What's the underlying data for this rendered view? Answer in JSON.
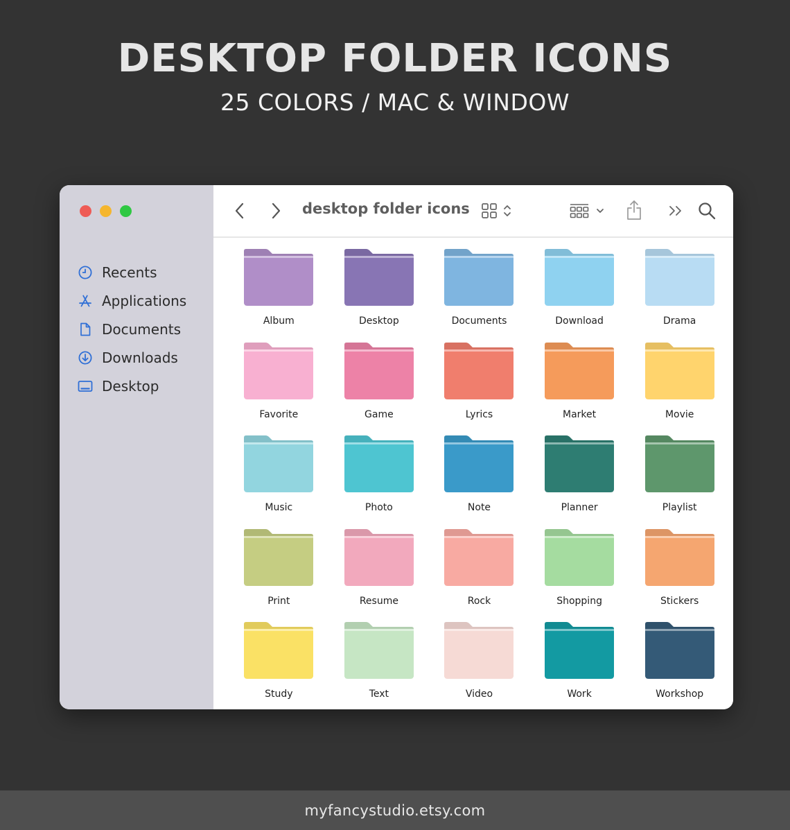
{
  "hero": {
    "title": "DESKTOP FOLDER ICONS",
    "subtitle": "25 COLORS / MAC & WINDOW"
  },
  "window": {
    "traffic_lights": {
      "red": "#ee5b55",
      "yellow": "#f5b62e",
      "green": "#2fc843"
    },
    "sidebar": {
      "accent": "#2f6fd6",
      "items": [
        {
          "label": "Recents",
          "icon": "clock-icon"
        },
        {
          "label": "Applications",
          "icon": "applications-icon"
        },
        {
          "label": "Documents",
          "icon": "document-icon"
        },
        {
          "label": "Downloads",
          "icon": "download-icon"
        },
        {
          "label": "Desktop",
          "icon": "desktop-icon"
        }
      ]
    },
    "toolbar": {
      "title": "desktop folder icons",
      "icons": [
        "back-chevron-icon",
        "forward-chevron-icon",
        "grid-view-icon",
        "group-by-icon",
        "share-icon",
        "more-icon",
        "search-icon"
      ]
    },
    "folders": [
      {
        "label": "Album",
        "color": "#b08ec8"
      },
      {
        "label": "Desktop",
        "color": "#8875b4"
      },
      {
        "label": "Documents",
        "color": "#7fb5e0"
      },
      {
        "label": "Download",
        "color": "#8fd2f0"
      },
      {
        "label": "Drama",
        "color": "#b8dcf3"
      },
      {
        "label": "Favorite",
        "color": "#f8b0d1"
      },
      {
        "label": "Game",
        "color": "#ed82a7"
      },
      {
        "label": "Lyrics",
        "color": "#f07e6d"
      },
      {
        "label": "Market",
        "color": "#f59b5b"
      },
      {
        "label": "Movie",
        "color": "#ffd46d"
      },
      {
        "label": "Music",
        "color": "#92d5df"
      },
      {
        "label": "Photo",
        "color": "#4ec5d1"
      },
      {
        "label": "Note",
        "color": "#3a9ac9"
      },
      {
        "label": "Planner",
        "color": "#2e7d72"
      },
      {
        "label": "Playlist",
        "color": "#5e976c"
      },
      {
        "label": "Print",
        "color": "#c5cd82"
      },
      {
        "label": "Resume",
        "color": "#f2a9bd"
      },
      {
        "label": "Rock",
        "color": "#f8aaa2"
      },
      {
        "label": "Shopping",
        "color": "#a5dca0"
      },
      {
        "label": "Stickers",
        "color": "#f5a670"
      },
      {
        "label": "Study",
        "color": "#fae165"
      },
      {
        "label": "Text",
        "color": "#c6e6c4"
      },
      {
        "label": "Video",
        "color": "#f6dad5"
      },
      {
        "label": "Work",
        "color": "#139aa2"
      },
      {
        "label": "Workshop",
        "color": "#345a77"
      }
    ]
  },
  "footer": {
    "text": "myfancystudio.etsy.com"
  }
}
